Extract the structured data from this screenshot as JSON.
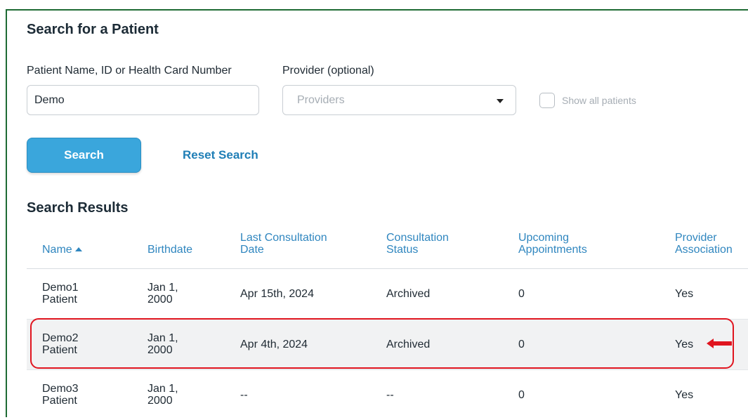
{
  "search": {
    "title": "Search for a Patient",
    "patient_label": "Patient Name, ID or Health Card Number",
    "patient_value": "Demo",
    "provider_label": "Provider (optional)",
    "provider_placeholder": "Providers",
    "show_all_label": "Show all patients",
    "show_all_checked": false,
    "search_button": "Search",
    "reset_link": "Reset Search"
  },
  "results": {
    "title": "Search Results",
    "columns": {
      "name": "Name",
      "birthdate": "Birthdate",
      "last_consult_1": "Last Consultation",
      "last_consult_2": "Date",
      "status_1": "Consultation",
      "status_2": "Status",
      "upcoming_1": "Upcoming",
      "upcoming_2": "Appointments",
      "provider_1": "Provider",
      "provider_2": "Association"
    },
    "sort": {
      "column": "Name",
      "direction": "ascending"
    },
    "rows": [
      {
        "name_1": "Demo1",
        "name_2": "Patient",
        "birth_1": "Jan 1,",
        "birth_2": "2000",
        "last_consultation": "Apr 15th, 2024",
        "status": "Archived",
        "upcoming": "0",
        "provider_association": "Yes"
      },
      {
        "name_1": "Demo2",
        "name_2": "Patient",
        "birth_1": "Jan 1,",
        "birth_2": "2000",
        "last_consultation": "Apr 4th, 2024",
        "status": "Archived",
        "upcoming": "0",
        "provider_association": "Yes"
      },
      {
        "name_1": "Demo3",
        "name_2": "Patient",
        "birth_1": "Jan 1,",
        "birth_2": "2000",
        "last_consultation": "--",
        "status": "--",
        "upcoming": "0",
        "provider_association": "Yes"
      }
    ]
  },
  "annotation": {
    "highlighted_row": 2,
    "highlight_color": "#e0151f",
    "arrow_icon": "left-arrow-icon"
  },
  "colors": {
    "accent": "#3aa6dc",
    "link": "#1f7eb6",
    "header_text": "#2f86bf",
    "frame_border": "#1e6b34"
  }
}
